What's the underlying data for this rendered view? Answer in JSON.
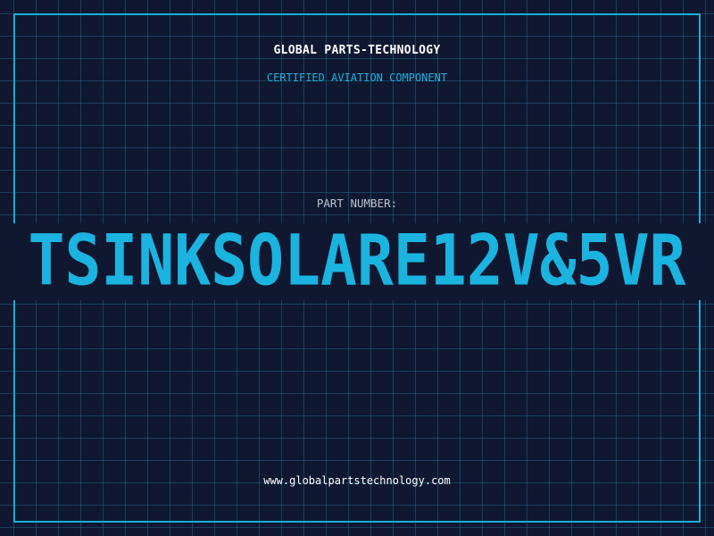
{
  "header": {
    "company_name": "GLOBAL PARTS-TECHNOLOGY",
    "tagline": "CERTIFIED AVIATION COMPONENT"
  },
  "part": {
    "label": "PART NUMBER:",
    "number": "TSINKSOLARE12V&5VR"
  },
  "footer": {
    "website": "www.globalpartstechnology.com"
  },
  "colors": {
    "background": "#0f1830",
    "grid": "#266e96",
    "accent": "#1bb3e0",
    "border": "#16aed6",
    "text_primary": "#ffffff",
    "text_secondary": "#b9c2cf"
  }
}
